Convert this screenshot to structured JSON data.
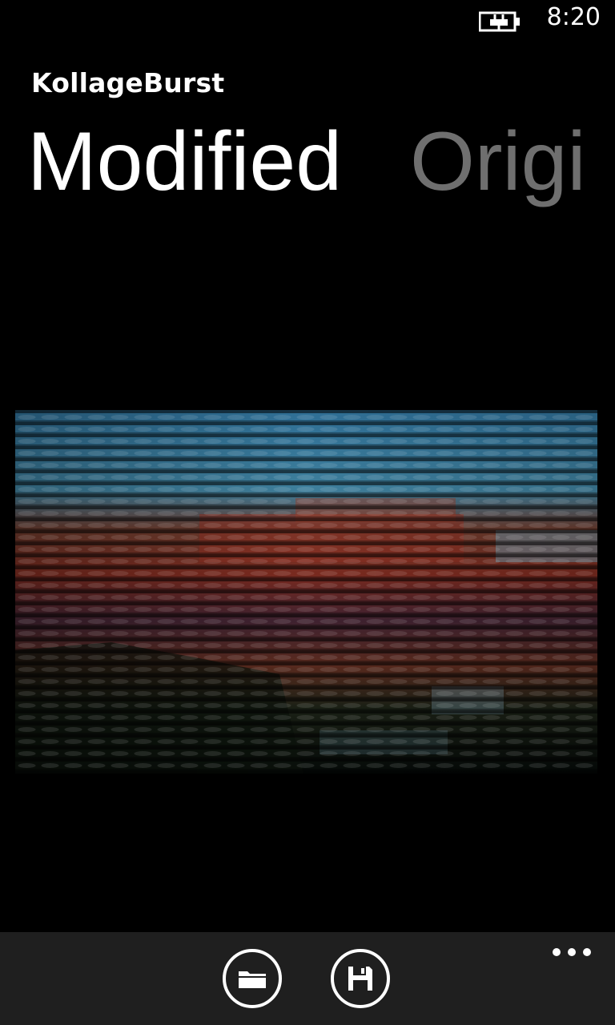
{
  "status": {
    "time": "8:20",
    "battery_icon": "battery-charging-icon"
  },
  "app": {
    "title": "KollageBurst"
  },
  "pivot": {
    "tabs": [
      {
        "label": "Modified"
      },
      {
        "label": "Origi"
      }
    ]
  },
  "image": {
    "icon": "mosaic-image"
  },
  "app_bar": {
    "buttons": [
      {
        "icon": "folder-icon"
      },
      {
        "icon": "save-icon"
      }
    ],
    "more_icon": "more-icon"
  },
  "colors": {
    "background": "#000000",
    "app_bar": "#1f1f1f",
    "inactive_tab": "#6f6f6f"
  }
}
